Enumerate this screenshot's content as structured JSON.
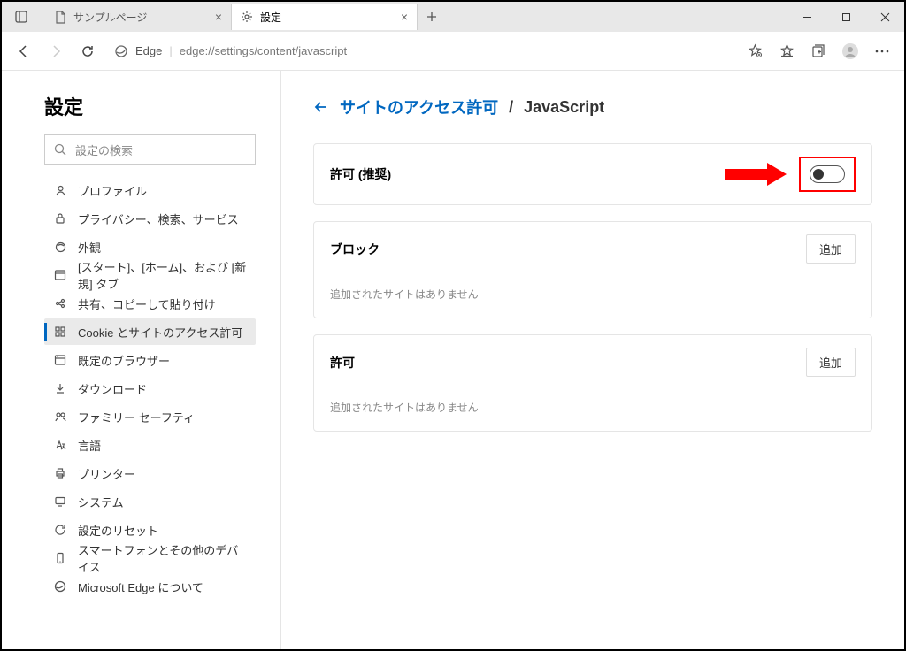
{
  "window": {
    "tabs": [
      {
        "title": "サンプルページ",
        "active": false
      },
      {
        "title": "設定",
        "active": true
      }
    ]
  },
  "addressbar": {
    "engine": "Edge",
    "url": "edge://settings/content/javascript"
  },
  "sidebar": {
    "title": "設定",
    "search_placeholder": "設定の検索",
    "items": [
      {
        "label": "プロファイル"
      },
      {
        "label": "プライバシー、検索、サービス"
      },
      {
        "label": "外観"
      },
      {
        "label": "[スタート]、[ホーム]、および [新規] タブ"
      },
      {
        "label": "共有、コピーして貼り付け"
      },
      {
        "label": "Cookie とサイトのアクセス許可"
      },
      {
        "label": "既定のブラウザー"
      },
      {
        "label": "ダウンロード"
      },
      {
        "label": "ファミリー セーフティ"
      },
      {
        "label": "言語"
      },
      {
        "label": "プリンター"
      },
      {
        "label": "システム"
      },
      {
        "label": "設定のリセット"
      },
      {
        "label": "スマートフォンとその他のデバイス"
      },
      {
        "label": "Microsoft Edge について"
      }
    ]
  },
  "main": {
    "breadcrumb_link": "サイトのアクセス許可",
    "breadcrumb_sep": "/",
    "breadcrumb_current": "JavaScript",
    "allow_label": "許可 (推奨)",
    "block_label": "ブロック",
    "add_label": "追加",
    "empty_text": "追加されたサイトはありません",
    "allow_section_label": "許可"
  }
}
